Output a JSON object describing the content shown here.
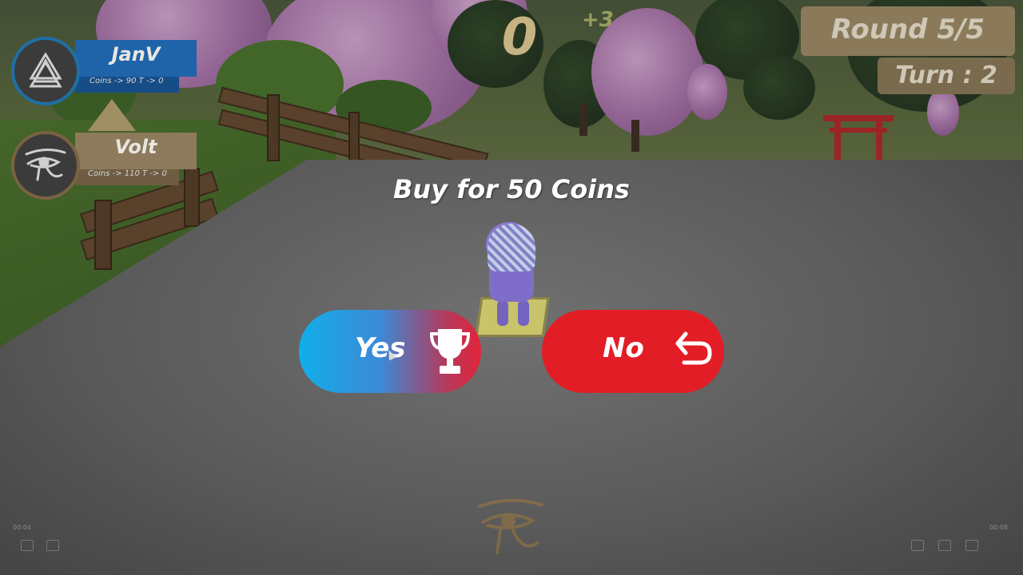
{
  "players": [
    {
      "name": "JanV",
      "stats": "Coins -> 90   T -> 0",
      "avatar_icon": "valknut-icon",
      "plate_color": "#1f63a8"
    },
    {
      "name": "Volt",
      "stats": "Coins -> 110   T -> 0",
      "avatar_icon": "eye-of-horus-icon",
      "plate_color": "#8d7a5c"
    }
  ],
  "dice": {
    "value": "0",
    "bonus": "+3"
  },
  "hud": {
    "round": "Round 5/5",
    "turn": "Turn : 2"
  },
  "prompt": {
    "text": "Buy for 50 Coins"
  },
  "buttons": {
    "yes": {
      "label": "Yes",
      "icon": "trophy-icon"
    },
    "no": {
      "label": "No",
      "icon": "return-arrow-icon"
    }
  },
  "video": {
    "time_left": "00:04",
    "time_right": "00:08"
  },
  "colors": {
    "yes_start": "#10aeea",
    "yes_end": "#e2243a",
    "no": "#e31d25",
    "hud_tan": "#8b7a5a"
  }
}
